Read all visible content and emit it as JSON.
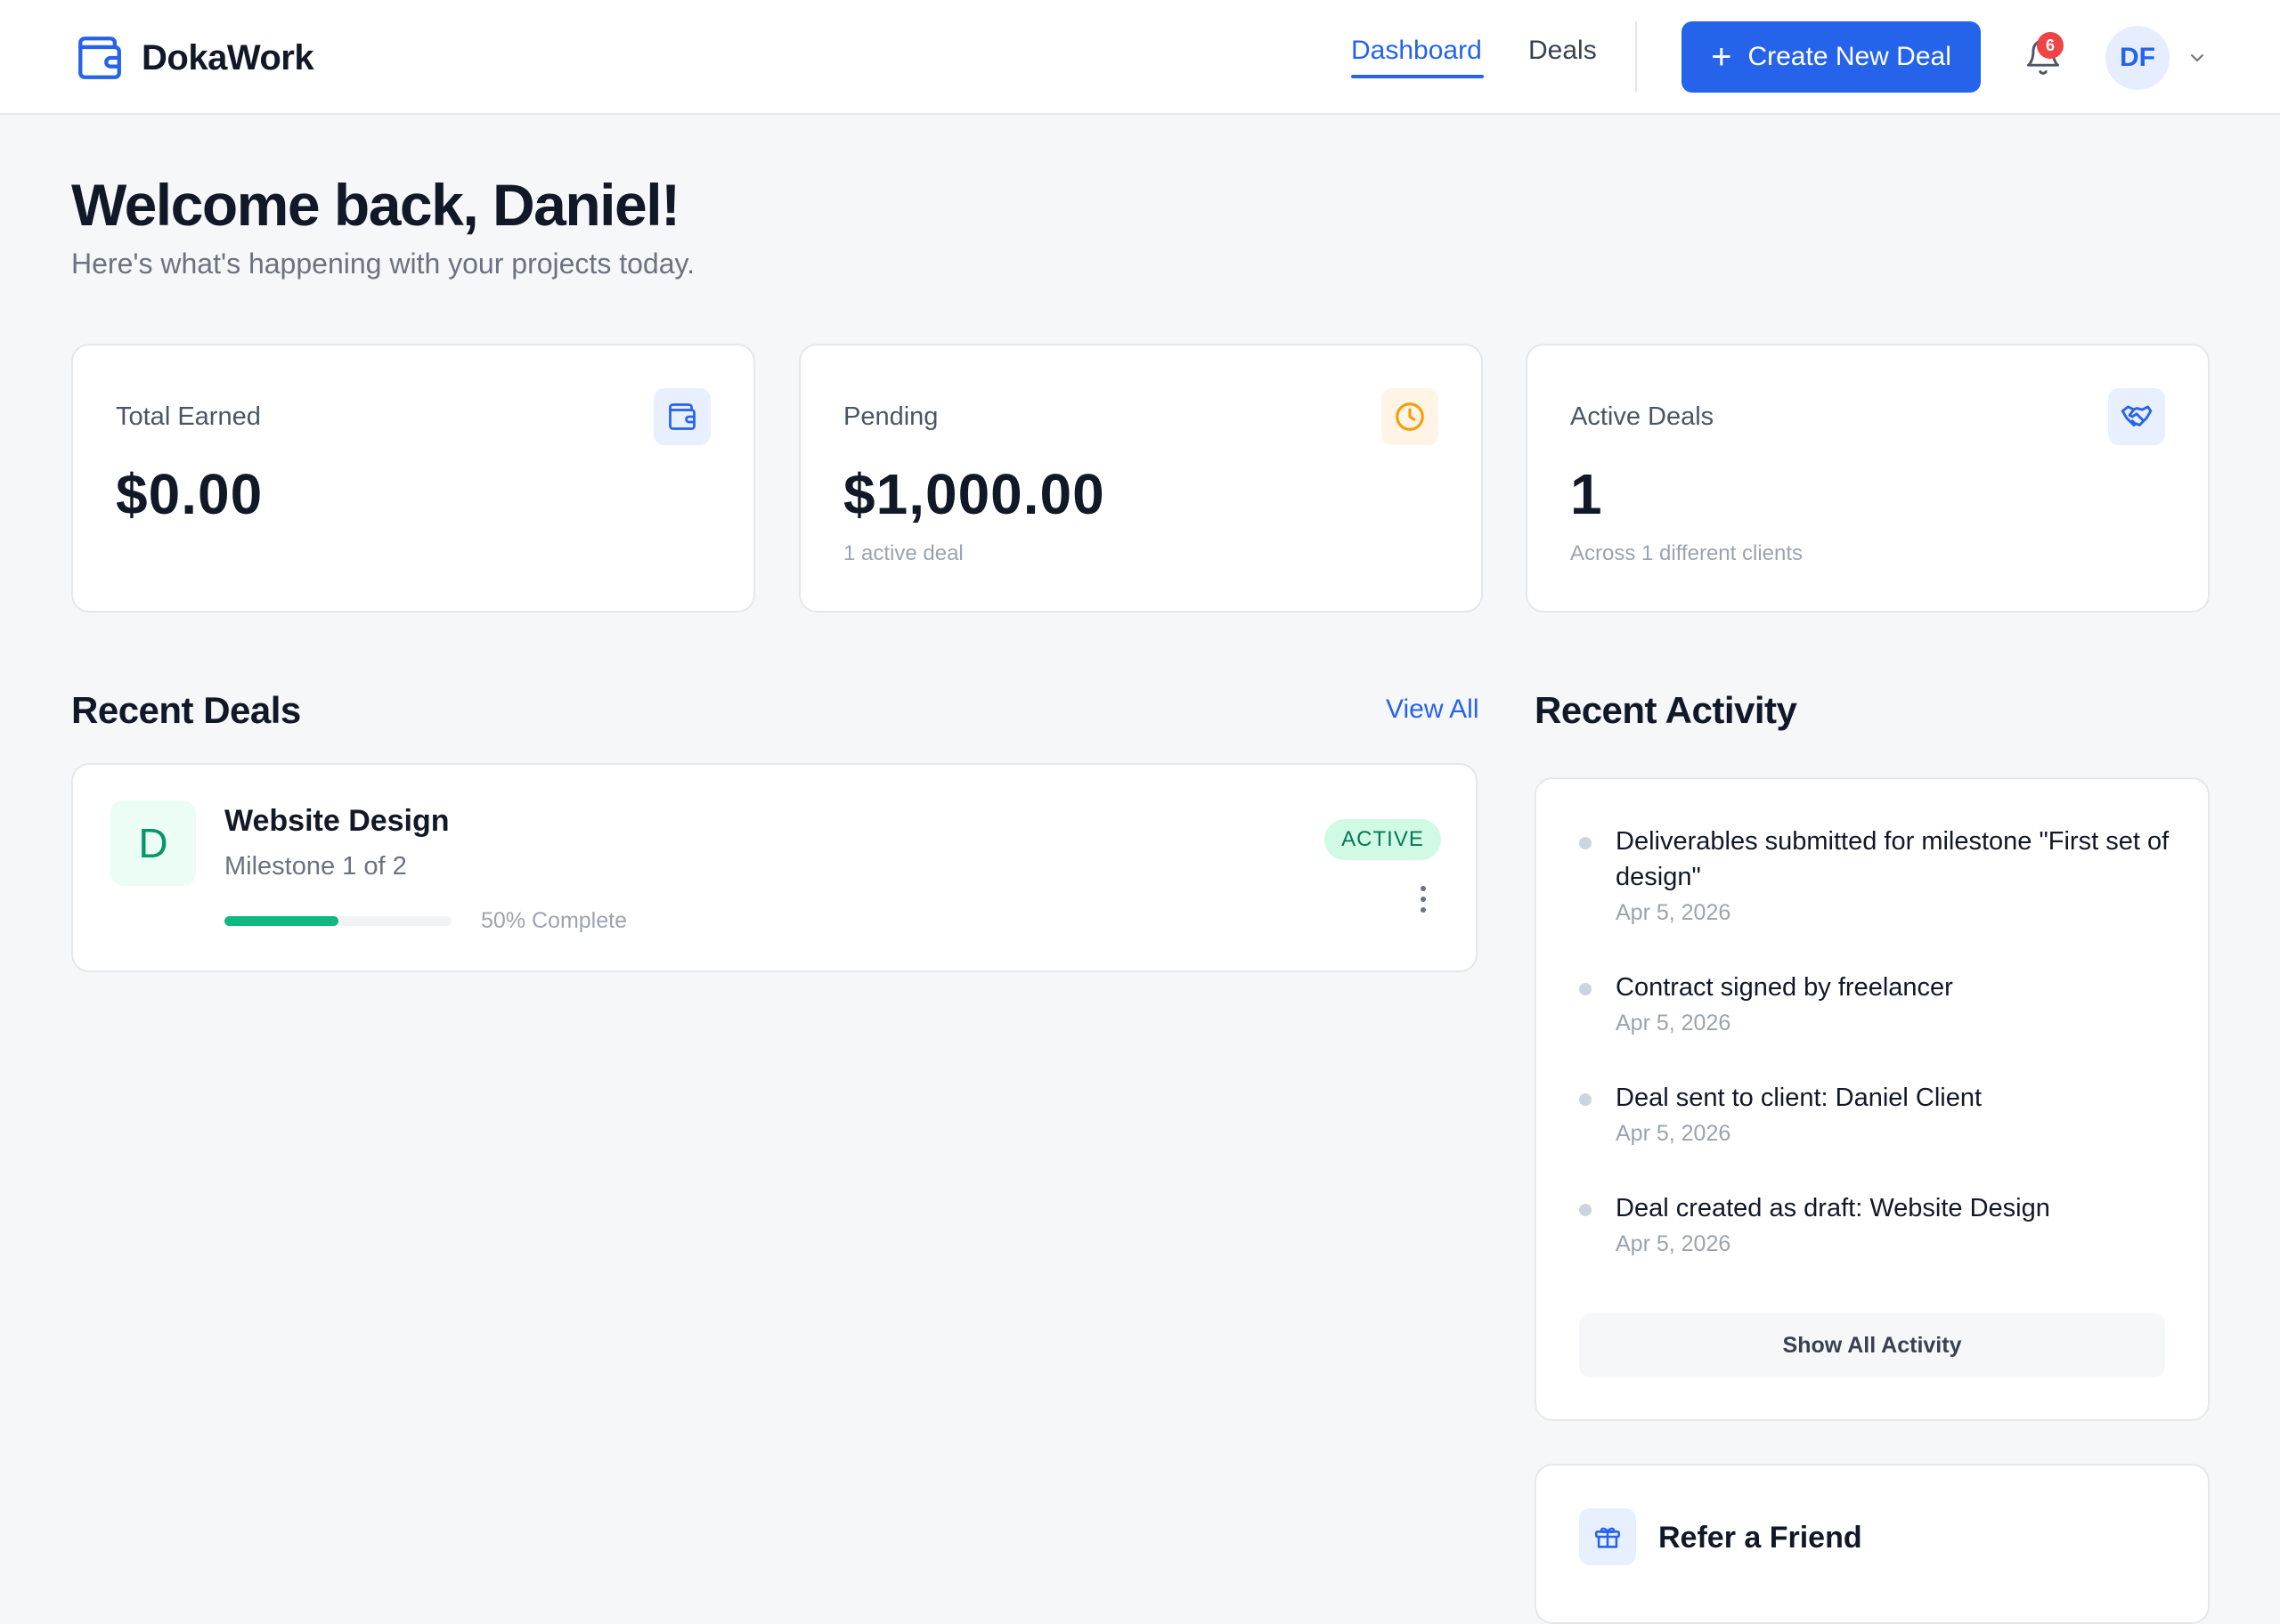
{
  "app": {
    "name": "DokaWork"
  },
  "nav": {
    "items": [
      {
        "label": "Dashboard",
        "active": true
      },
      {
        "label": "Deals",
        "active": false
      }
    ],
    "create_label": "Create New Deal",
    "notifications_count": "6",
    "user_initials": "DF"
  },
  "welcome": {
    "title": "Welcome back, Daniel!",
    "subtitle": "Here's what's happening with your projects today."
  },
  "stats": [
    {
      "label": "Total Earned",
      "value": "$0.00",
      "sub": "",
      "icon": "wallet-icon"
    },
    {
      "label": "Pending",
      "value": "$1,000.00",
      "sub": "1 active deal",
      "icon": "clock-icon"
    },
    {
      "label": "Active Deals",
      "value": "1",
      "sub": "Across 1 different clients",
      "icon": "handshake-icon"
    }
  ],
  "recent_deals": {
    "title": "Recent Deals",
    "view_all": "View All",
    "items": [
      {
        "initial": "D",
        "name": "Website Design",
        "milestone": "Milestone 1 of 2",
        "progress": 50,
        "progress_label": "50% Complete",
        "status": "ACTIVE"
      }
    ]
  },
  "recent_activity": {
    "title": "Recent Activity",
    "items": [
      {
        "text": "Deliverables submitted for milestone \"First set of design\"",
        "date": "Apr 5, 2026"
      },
      {
        "text": "Contract signed by freelancer",
        "date": "Apr 5, 2026"
      },
      {
        "text": "Deal sent to client: Daniel Client",
        "date": "Apr 5, 2026"
      },
      {
        "text": "Deal created as draft: Website Design",
        "date": "Apr 5, 2026"
      }
    ],
    "show_all": "Show All Activity"
  },
  "refer": {
    "title": "Refer a Friend",
    "icon": "gift-icon"
  },
  "colors": {
    "primary": "#2563eb",
    "success": "#10b981",
    "warning": "#f59e0b",
    "danger": "#ef4444",
    "background": "#f6f7f9"
  }
}
